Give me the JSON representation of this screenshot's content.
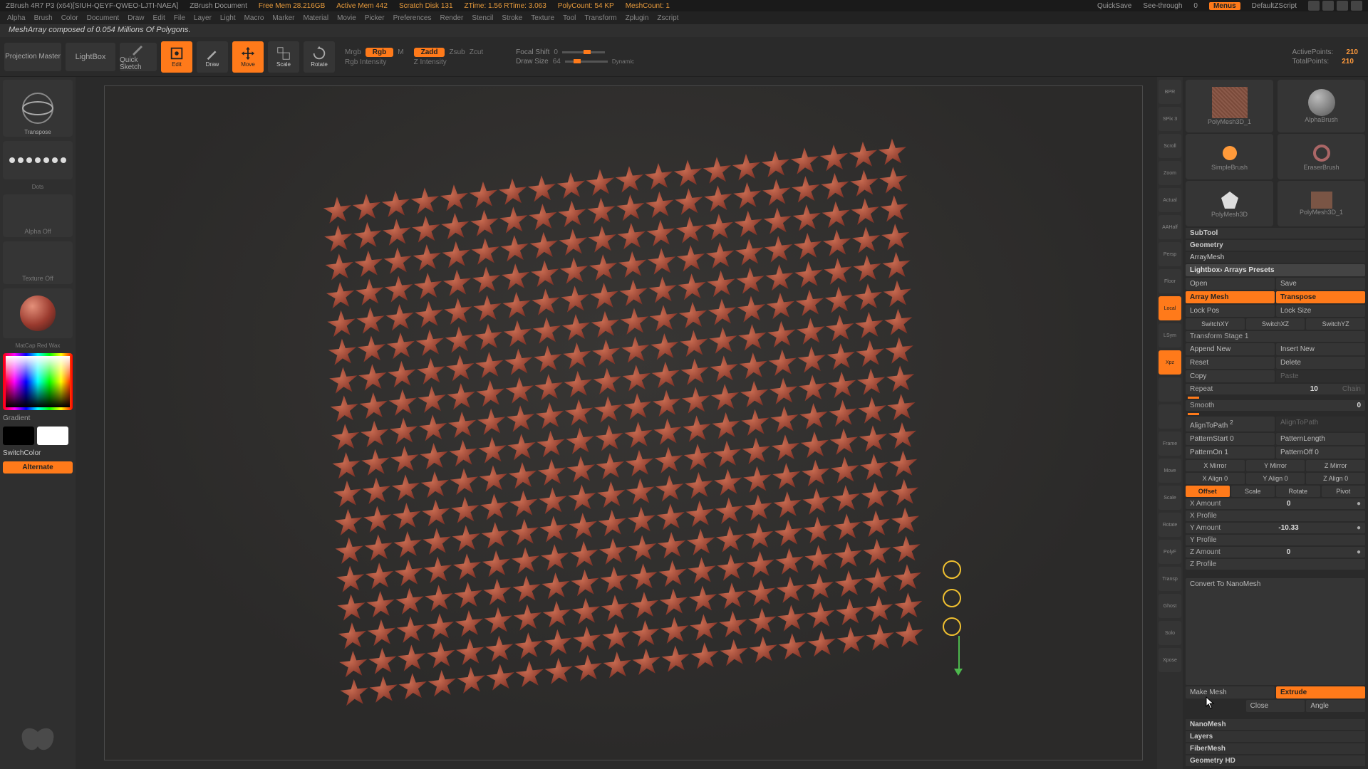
{
  "titlebar": {
    "app": "ZBrush 4R7 P3 (x64)[SIUH-QEYF-QWEO-LJTI-NAEA]",
    "doc": "ZBrush Document",
    "mem": "Free Mem 28.216GB",
    "active": "Active Mem 442",
    "scratch": "Scratch Disk 131",
    "ztime": "ZTime: 1.56  RTime: 3.063",
    "poly": "PolyCount: 54 KP",
    "meshcount": "MeshCount: 1",
    "quicksave": "QuickSave",
    "seethru": "See-through",
    "seethru_val": "0",
    "menus": "Menus",
    "script": "DefaultZScript"
  },
  "menubar": [
    "Alpha",
    "Brush",
    "Color",
    "Document",
    "Draw",
    "Edit",
    "File",
    "Layer",
    "Light",
    "Macro",
    "Marker",
    "Material",
    "Movie",
    "Picker",
    "Preferences",
    "Render",
    "Stencil",
    "Stroke",
    "Texture",
    "Tool",
    "Transform",
    "Zplugin",
    "Zscript"
  ],
  "info": "MeshArray composed of 0.054 Millions Of Polygons.",
  "toolbar": {
    "projection": "Projection\nMaster",
    "lightbox": "LightBox",
    "quicksketch": "Quick Sketch",
    "edit": "Edit",
    "draw": "Draw",
    "move": "Move",
    "scale": "Scale",
    "rotate": "Rotate",
    "mrgb": "Mrgb",
    "rgb": "Rgb",
    "m": "M",
    "rgbint": "Rgb Intensity",
    "zadd": "Zadd",
    "zsub": "Zsub",
    "zcut": "Zcut",
    "zint": "Z Intensity",
    "focal": "Focal Shift",
    "focal_val": "0",
    "drawsize": "Draw Size",
    "drawsize_val": "64",
    "dynamic": "Dynamic",
    "active_pts": "ActivePoints:",
    "active_val": "210",
    "total_pts": "TotalPoints:",
    "total_val": "210"
  },
  "left": {
    "transpose": "Transpose",
    "dots": "Dots",
    "alpha": "Alpha Off",
    "texture": "Texture Off",
    "material": "MatCap Red Wax",
    "gradient": "Gradient",
    "switch": "SwitchColor",
    "alternate": "Alternate"
  },
  "rstrip": [
    "BPR",
    "SPix 3",
    "Scroll",
    "Zoom",
    "Actual",
    "AAHalf",
    "Persp",
    "Floor",
    "Local",
    "LSym",
    "Xpz",
    "",
    "",
    "Frame",
    "Move",
    "Scale",
    "Rotate",
    "PolyF",
    "Transp",
    "Ghost",
    "Solo",
    "Xpose"
  ],
  "thumbs": [
    "PolyMesh3D_1",
    "AlphaBrush",
    "SimpleBrush",
    "EraserBrush",
    "PolyMesh3D",
    "PolyMesh3D_1"
  ],
  "panel": {
    "subtool": "SubTool",
    "geometry": "Geometry",
    "arraymesh": "ArrayMesh",
    "preset": "Lightbox› Arrays Presets",
    "open": "Open",
    "save": "Save",
    "array": "Array Mesh",
    "transpose": "Transpose",
    "lockpos": "Lock Pos",
    "locksize": "Lock Size",
    "sxy": "SwitchXY",
    "sxz": "SwitchXZ",
    "syz": "SwitchYZ",
    "tstage": "Transform Stage 1",
    "append": "Append New",
    "insert": "Insert New",
    "reset": "Reset",
    "delete": "Delete",
    "copy": "Copy",
    "paste": "Paste",
    "repeat": "Repeat",
    "repeat_val": "10",
    "chain": "Chain",
    "smooth": "Smooth",
    "smooth_val": "0",
    "aligntopath": "AlignToPath",
    "aligntopath_exp": "2",
    "aligntopath2": "AlignToPath",
    "pstart": "PatternStart",
    "pstart_val": "0",
    "plength": "PatternLength",
    "pon": "PatternOn",
    "pon_val": "1",
    "poff": "PatternOff",
    "poff_val": "0",
    "xmirror": "X Mirror",
    "ymirror": "Y Mirror",
    "zmirror": "Z Mirror",
    "xalign": "X Align 0",
    "yalign": "Y Align 0",
    "zalign": "Z Align 0",
    "offset": "Offset",
    "scale": "Scale",
    "rotate": "Rotate",
    "pivot": "Pivot",
    "xamt": "X Amount",
    "xamt_val": "0",
    "xprof": "X Profile",
    "yamt": "Y Amount",
    "yamt_val": "-10.33",
    "yprof": "Y Profile",
    "zamt": "Z Amount",
    "zamt_val": "0",
    "zprof": "Z Profile",
    "convert": "Convert To NanoMesh",
    "makemesh": "Make Mesh",
    "extrude": "Extrude",
    "close": "Close",
    "angle": "Angle",
    "nanomesh": "NanoMesh",
    "layers": "Layers",
    "fibermesh": "FiberMesh",
    "geohd": "Geometry HD"
  }
}
